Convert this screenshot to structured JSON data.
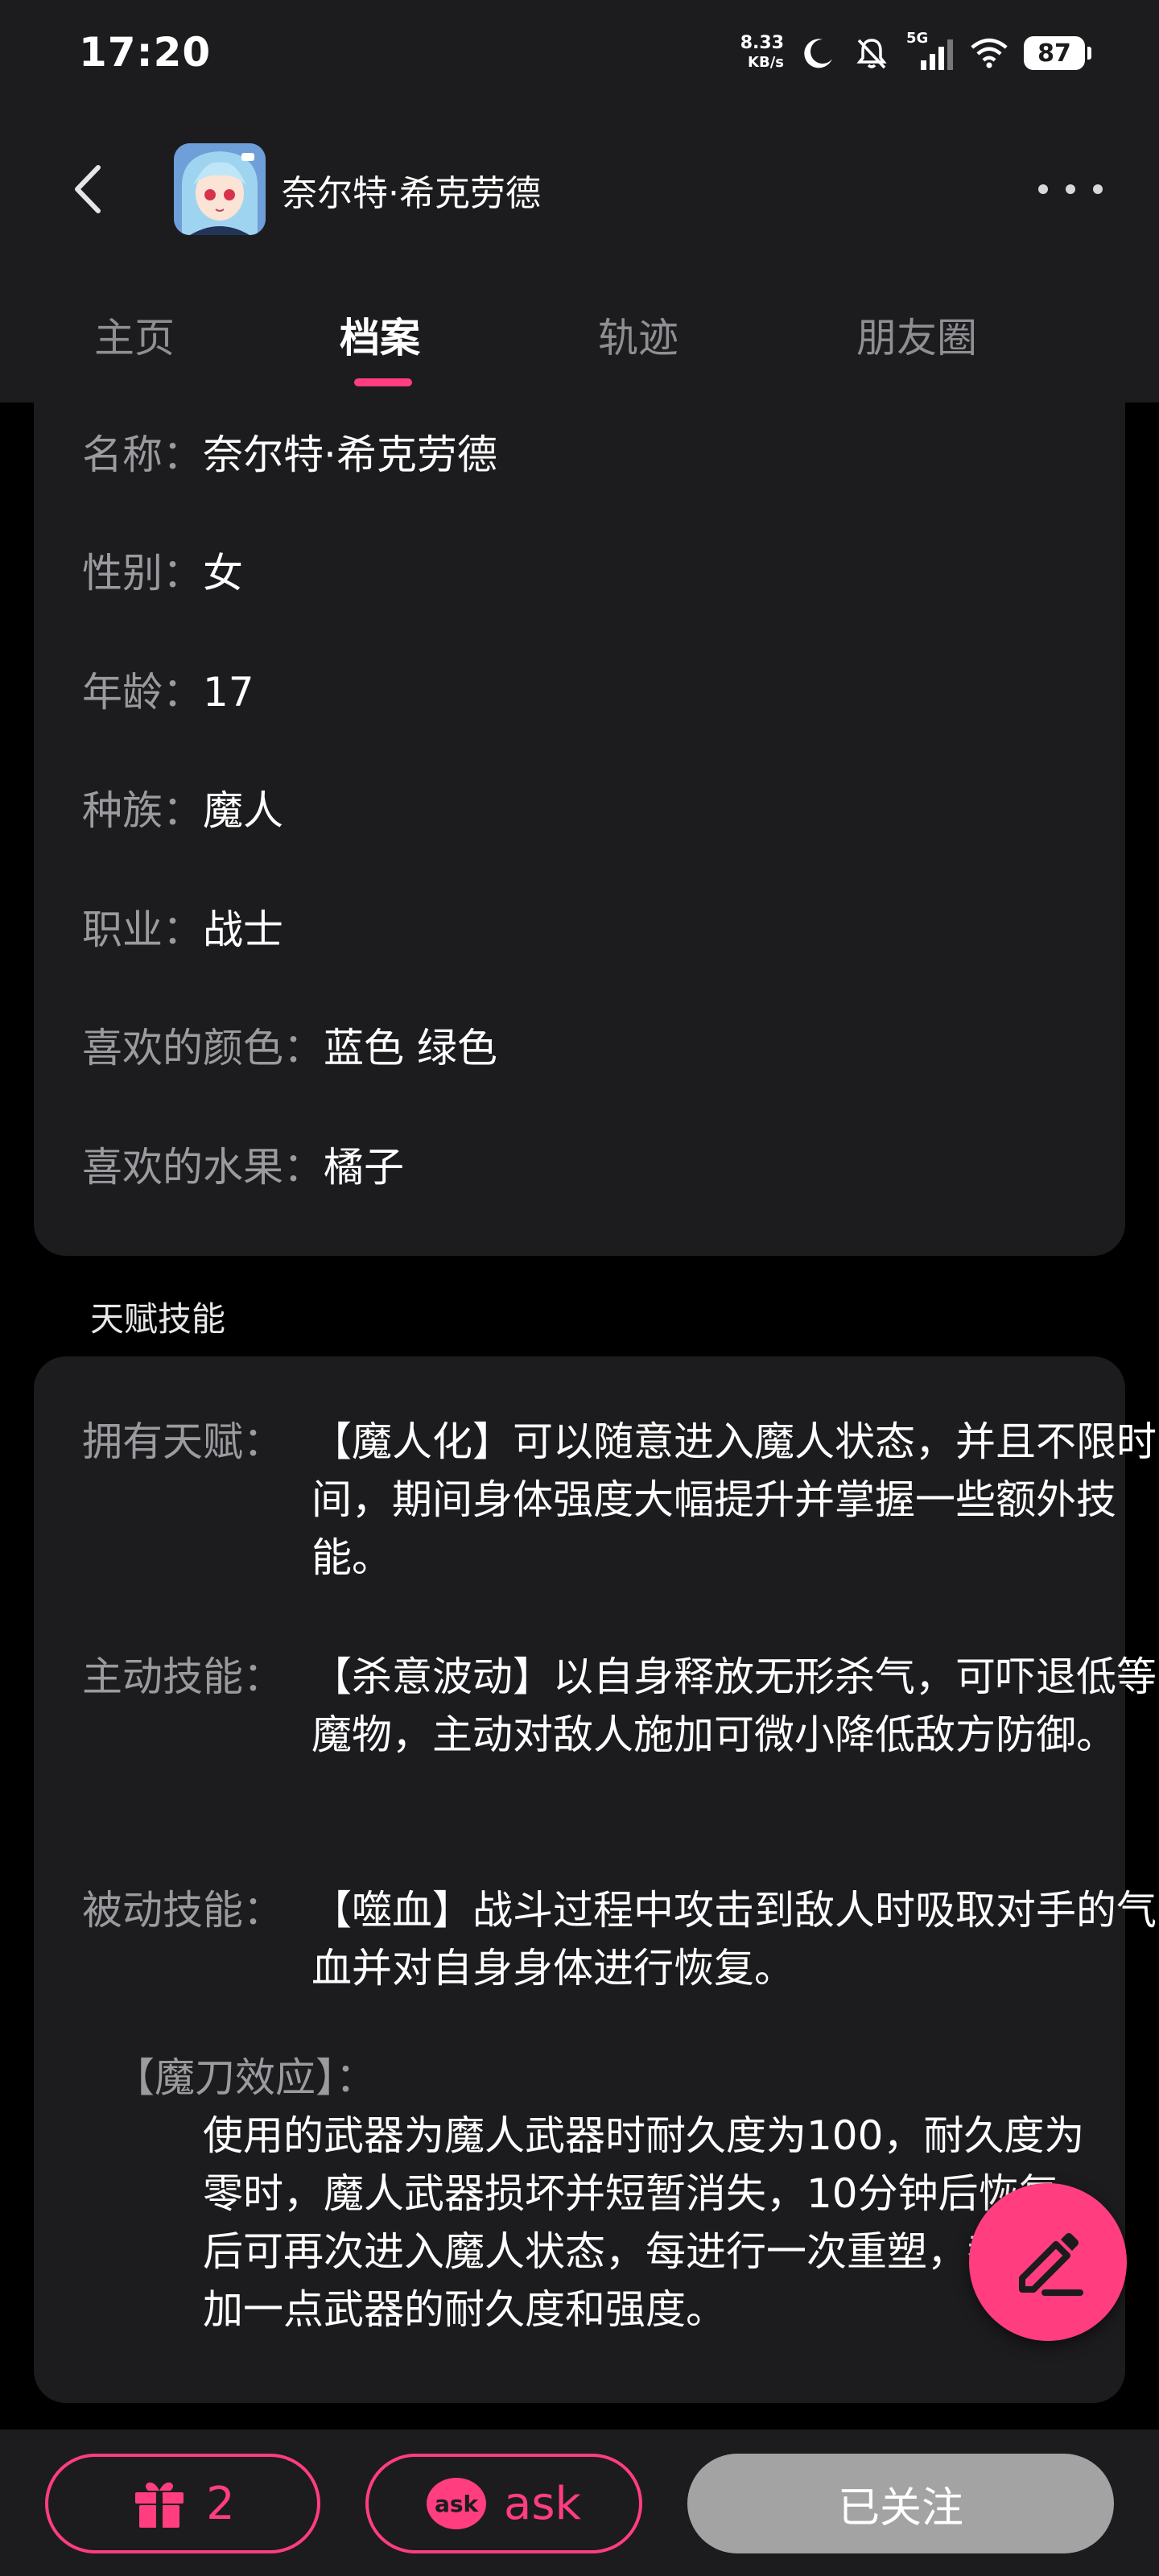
{
  "status_bar": {
    "time": "17:20",
    "speed_value": "8.33",
    "speed_unit": "KB/s",
    "network": "5G",
    "battery": "87"
  },
  "header": {
    "character_name": "奈尔特·希克劳德",
    "icons": [
      "back-icon",
      "avatar",
      "more-icon"
    ]
  },
  "tabs": [
    {
      "label": "主页",
      "active": false
    },
    {
      "label": "档案",
      "active": true
    },
    {
      "label": "轨迹",
      "active": false
    },
    {
      "label": "朋友圈",
      "active": false
    }
  ],
  "profile": [
    {
      "key": "名称：",
      "value": "奈尔特·希克劳德"
    },
    {
      "key": "性别：",
      "value": "女"
    },
    {
      "key": "年龄：",
      "value": "17"
    },
    {
      "key": "种族：",
      "value": "魔人"
    },
    {
      "key": "职业：",
      "value": "战士"
    },
    {
      "key": "喜欢的颜色：",
      "value": "蓝色 绿色"
    },
    {
      "key": "喜欢的水果：",
      "value": "橘子"
    }
  ],
  "talents": {
    "section_title": "天赋技能",
    "items": [
      {
        "key": "拥有天赋：",
        "value": "【魔人化】可以随意进入魔人状态，并且不限时间，期间身体强度大幅提升并掌握一些额外技能。"
      },
      {
        "key": "主动技能：",
        "value": "【杀意波动】以自身释放无形杀气，可吓退低等魔物，主动对敌人施加可微小降低敌方防御。"
      },
      {
        "key": "被动技能：",
        "value": "【噬血】战斗过程中攻击到敌人时吸取对手的气血并对自身身体进行恢复。"
      },
      {
        "key": "【魔刀效应】：",
        "value": "使用的武器为魔人武器时耐久度为100，耐久度为零时，魔人武器损坏并短暂消失，10分钟后恢复，后可再次进入魔人状态，每进行一次重塑，都会增加一点武器的耐久度和强度。"
      }
    ]
  },
  "bottom_bar": {
    "gift_count": "2",
    "ask_badge": "ask",
    "ask_label": "ask",
    "follow_label": "已关注"
  },
  "colors": {
    "accent": "#ff3d7f",
    "card": "#1c1c1e",
    "background": "#000000",
    "muted_text": "#9a9a9f",
    "follow_button": "#a3a3a3"
  }
}
